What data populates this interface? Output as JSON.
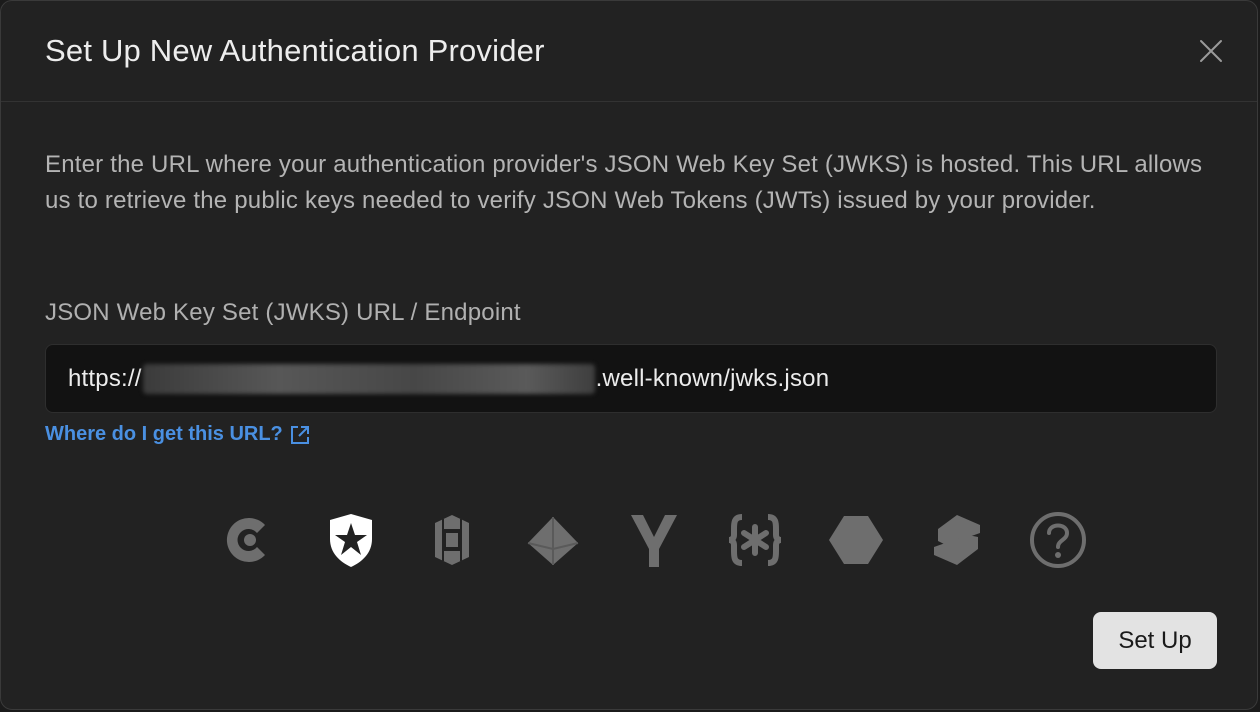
{
  "dialog": {
    "title": "Set Up New Authentication Provider",
    "close_icon": "close-icon"
  },
  "description": "Enter the URL where your authentication provider's JSON Web Key Set (JWKS) is hosted. This URL allows us to retrieve the public keys needed to verify JSON Web Tokens (JWTs) issued by your provider.",
  "field": {
    "label": "JSON Web Key Set (JWKS) URL / Endpoint",
    "value_prefix": "https://",
    "value_suffix": ".well-known/jwks.json"
  },
  "help_link": {
    "label": "Where do I get this URL?",
    "icon": "external-link-icon"
  },
  "providers": [
    {
      "icon": "clerk-icon",
      "selected": false
    },
    {
      "icon": "auth0-shield-icon",
      "selected": true
    },
    {
      "icon": "amazon-cognito-icon",
      "selected": false
    },
    {
      "icon": "firebase-diamond-icon",
      "selected": false
    },
    {
      "icon": "y-provider-icon",
      "selected": false
    },
    {
      "icon": "stytch-icon",
      "selected": false
    },
    {
      "icon": "hexagon-provider-icon",
      "selected": false
    },
    {
      "icon": "layers-provider-icon",
      "selected": false
    },
    {
      "icon": "question-icon",
      "selected": false
    }
  ],
  "colors": {
    "accent_link": "#4a90e2",
    "background": "#222222",
    "provider_muted": "#6e6e6e",
    "provider_selected": "#ffffff"
  },
  "actions": {
    "setup_label": "Set Up"
  }
}
